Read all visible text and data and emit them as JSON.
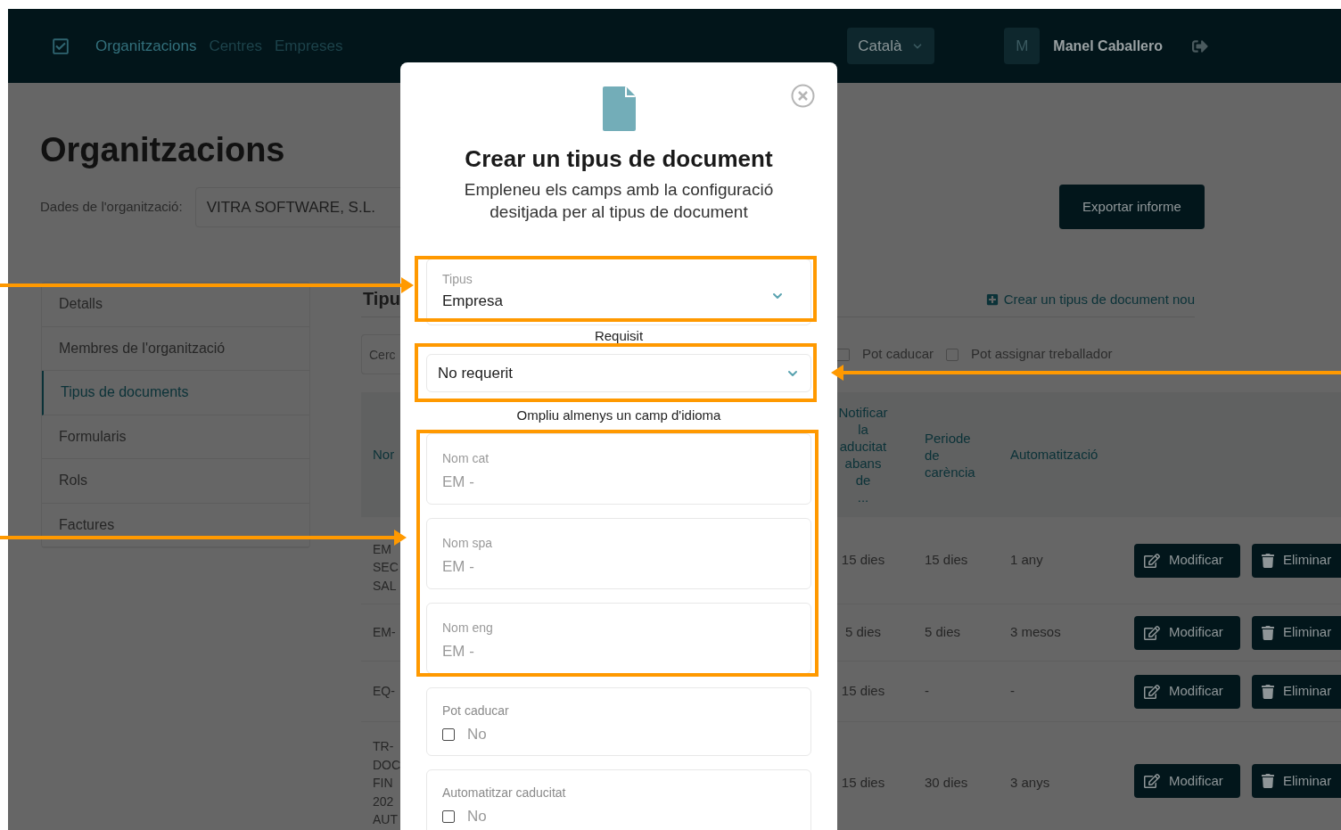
{
  "navbar": {
    "links": [
      {
        "label": "Organitzacions",
        "selected": true
      },
      {
        "label": "Centres",
        "selected": false
      },
      {
        "label": "Empreses",
        "selected": false
      }
    ],
    "language": "Català",
    "avatar_initial": "M",
    "user_name": "Manel Caballero"
  },
  "page": {
    "title": "Organitzacions",
    "org_label": "Dades de l'organització:",
    "org_value": "VITRA SOFTWARE, S.L.",
    "export_button": "Exportar informe"
  },
  "sidebar": {
    "items": [
      {
        "label": "Detalls",
        "selected": false
      },
      {
        "label": "Membres de l'organització",
        "selected": false
      },
      {
        "label": "Tipus de documents",
        "selected": true
      },
      {
        "label": "Formularis",
        "selected": false
      },
      {
        "label": "Rols",
        "selected": false
      },
      {
        "label": "Factures",
        "selected": false
      }
    ]
  },
  "section": {
    "heading": "Tipu",
    "search_placeholder": "Cerc",
    "create_link": "Crear un tipus de document nou",
    "filters": [
      {
        "label": "Pot caducar",
        "checked": false
      },
      {
        "label": "Pot assignar treballador",
        "checked": false
      }
    ]
  },
  "table": {
    "columns": [
      "Nor",
      "Notificar\nla\naducitat\nabans de\n...",
      "Periode\nde\ncarència",
      "Automatització"
    ],
    "rows": [
      {
        "cells": [
          "EM\nSEC\nSAL",
          "15 dies",
          "15 dies",
          "1 any"
        ],
        "actions": [
          "Modificar",
          "Eliminar"
        ]
      },
      {
        "cells": [
          "EM-",
          "5 dies",
          "5 dies",
          "3 mesos"
        ],
        "actions": [
          "Modificar",
          "Eliminar"
        ]
      },
      {
        "cells": [
          "EQ-",
          "15 dies",
          "-",
          "-"
        ],
        "actions": [
          "Modificar",
          "Eliminar"
        ]
      },
      {
        "cells": [
          "TR-\nDOC\nFIN\n202\nAUT",
          "15 dies",
          "30 dies",
          "3 anys"
        ],
        "actions": [
          "Modificar",
          "Eliminar"
        ]
      }
    ]
  },
  "dialog": {
    "title": "Crear un tipus de document",
    "subtitle": "Empleneu els camps amb la configuració desitjada per al tipus de document",
    "fields": [
      {
        "kind": "select",
        "label": "Tipus",
        "value": "Empresa"
      },
      {
        "kind": "caption",
        "text": "Requisit"
      },
      {
        "kind": "select",
        "value": "No requerit"
      },
      {
        "kind": "caption",
        "text": "Ompliu almenys un camp d'idioma"
      },
      {
        "kind": "text",
        "label": "Nom cat",
        "value": "EM -"
      },
      {
        "kind": "text",
        "label": "Nom spa",
        "value": "EM -"
      },
      {
        "kind": "text",
        "label": "Nom eng",
        "value": "EM -"
      },
      {
        "kind": "checkbox",
        "label": "Pot caducar",
        "option": "No",
        "checked": false
      },
      {
        "kind": "checkbox",
        "label": "Automatitzar caducitat",
        "option": "No",
        "checked": false
      }
    ]
  }
}
